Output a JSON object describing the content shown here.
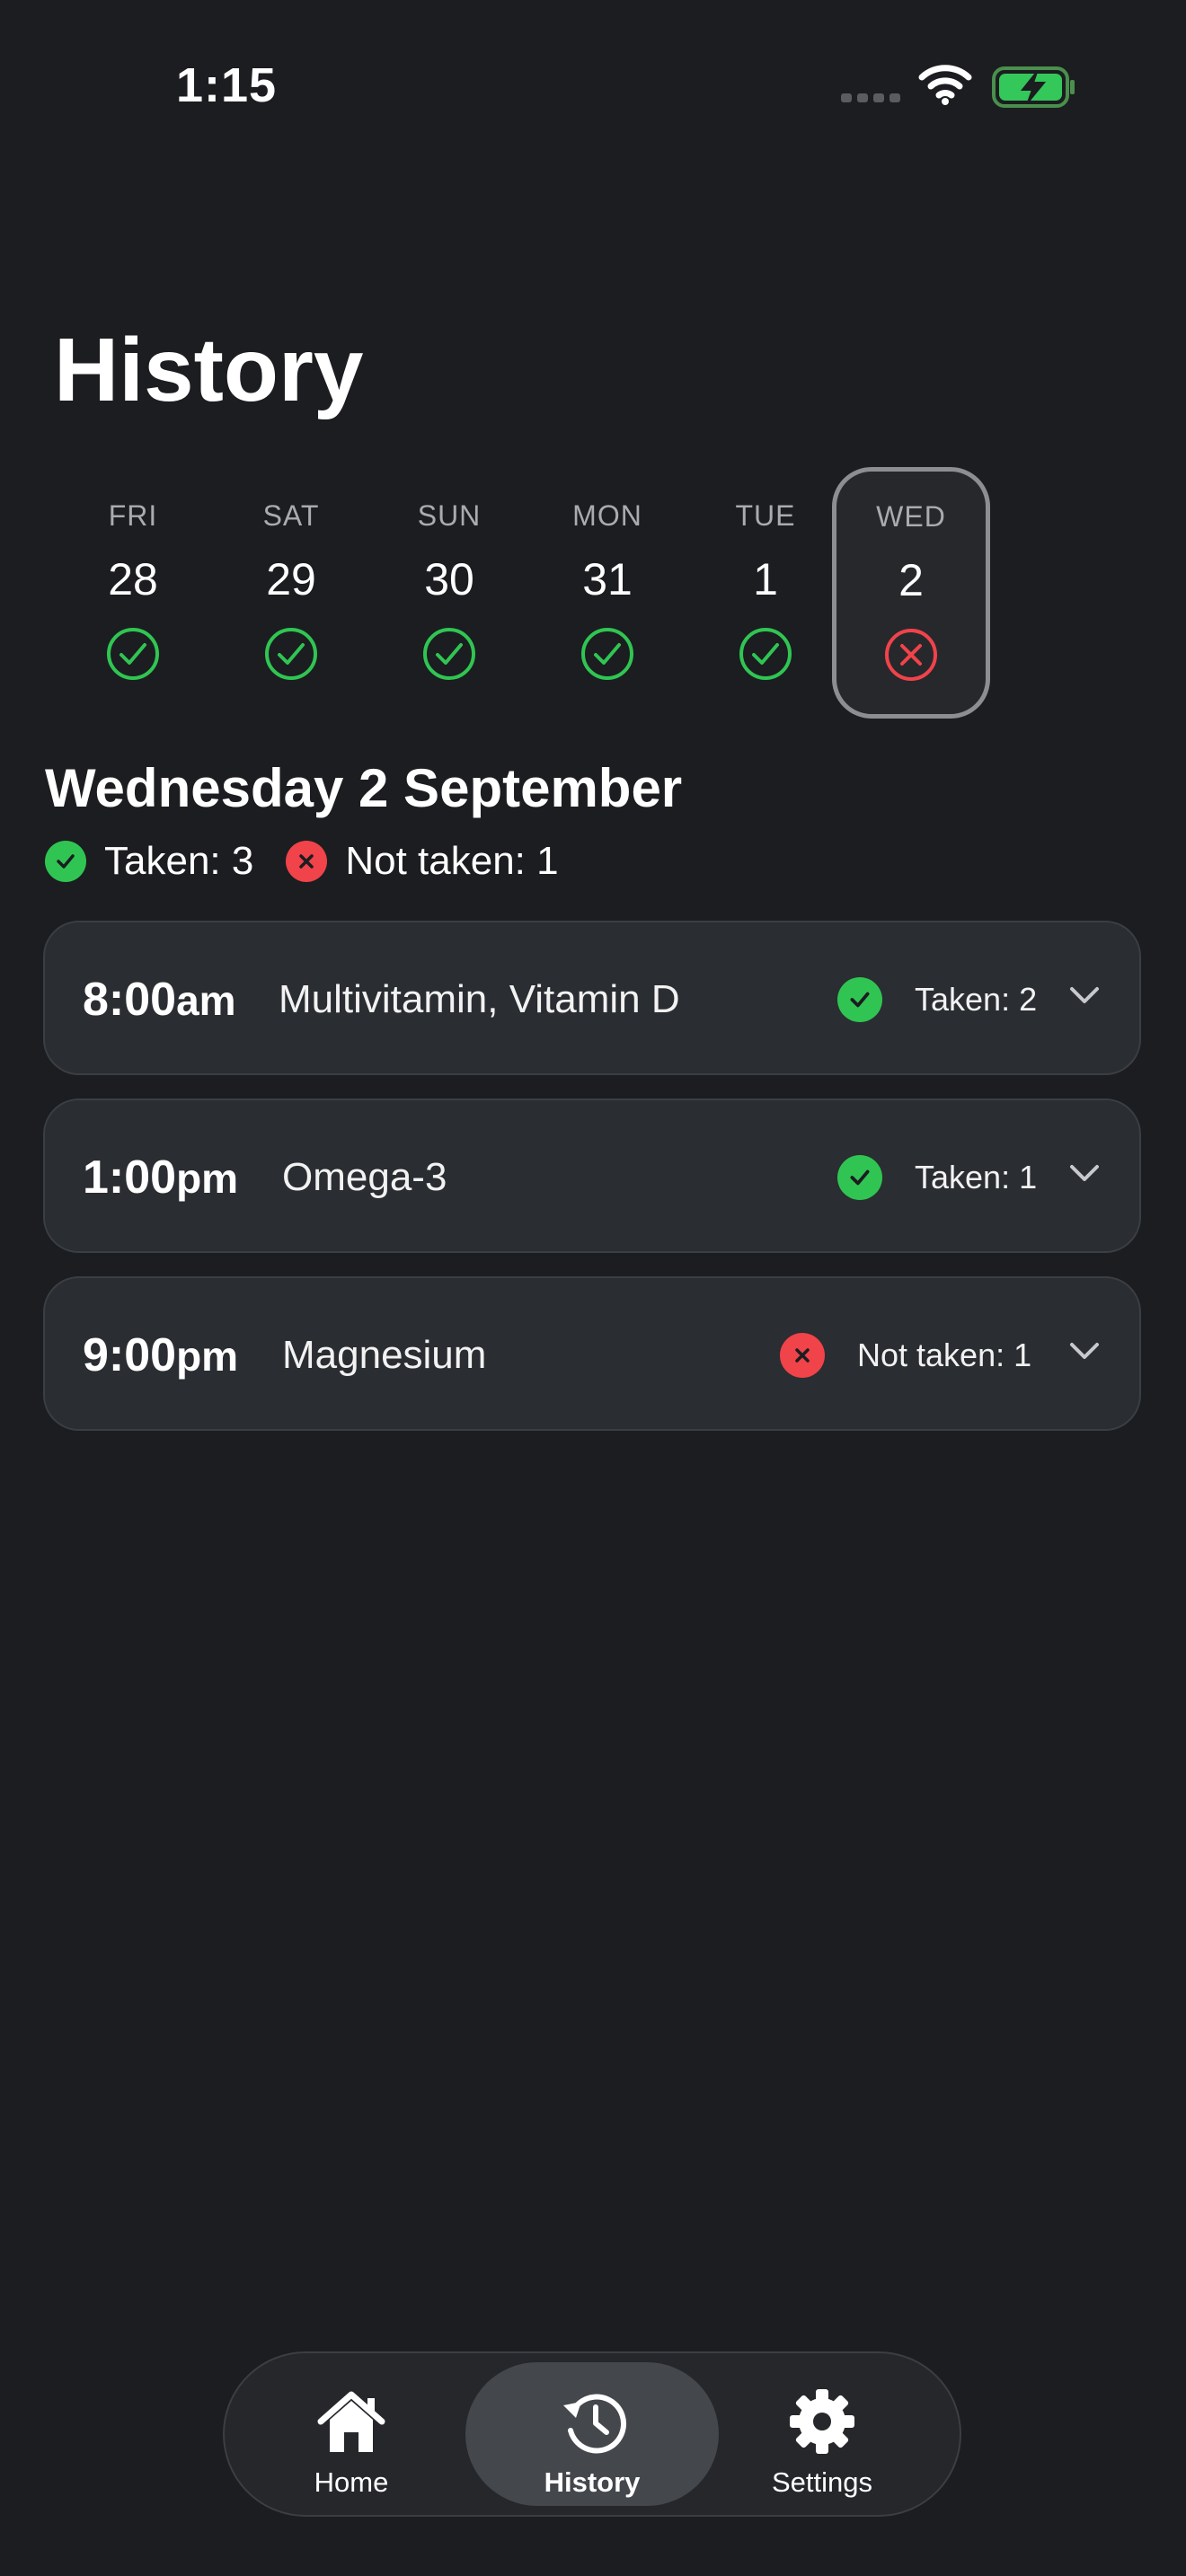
{
  "status_bar": {
    "time": "1:15"
  },
  "page": {
    "title": "History"
  },
  "days": [
    {
      "dow": "FRI",
      "num": "28",
      "status": "taken"
    },
    {
      "dow": "SAT",
      "num": "29",
      "status": "taken"
    },
    {
      "dow": "SUN",
      "num": "30",
      "status": "taken"
    },
    {
      "dow": "MON",
      "num": "31",
      "status": "taken"
    },
    {
      "dow": "TUE",
      "num": "1",
      "status": "taken"
    },
    {
      "dow": "WED",
      "num": "2",
      "status": "missed",
      "selected": true
    }
  ],
  "selected_day": {
    "heading": "Wednesday 2 September",
    "taken_summary": "Taken: 3",
    "not_taken_summary": "Not taken: 1"
  },
  "doses": [
    {
      "time": "8:00",
      "period": "am",
      "name": "Multivitamin, Vitamin D",
      "status": "taken",
      "status_label": "Taken: 2"
    },
    {
      "time": "1:00",
      "period": "pm",
      "name": "Omega-3",
      "status": "taken",
      "status_label": "Taken: 1"
    },
    {
      "time": "9:00",
      "period": "pm",
      "name": "Magnesium",
      "status": "missed",
      "status_label": "Not taken: 1"
    }
  ],
  "tabs": {
    "home": {
      "label": "Home",
      "icon": "house-icon"
    },
    "history": {
      "label": "History",
      "icon": "history-clock-icon",
      "active": true
    },
    "settings": {
      "label": "Settings",
      "icon": "gear-icon"
    }
  },
  "colors": {
    "background": "#1b1d20",
    "card": "#2a2d31",
    "taken": "#30c552",
    "missed": "#f0434a"
  }
}
